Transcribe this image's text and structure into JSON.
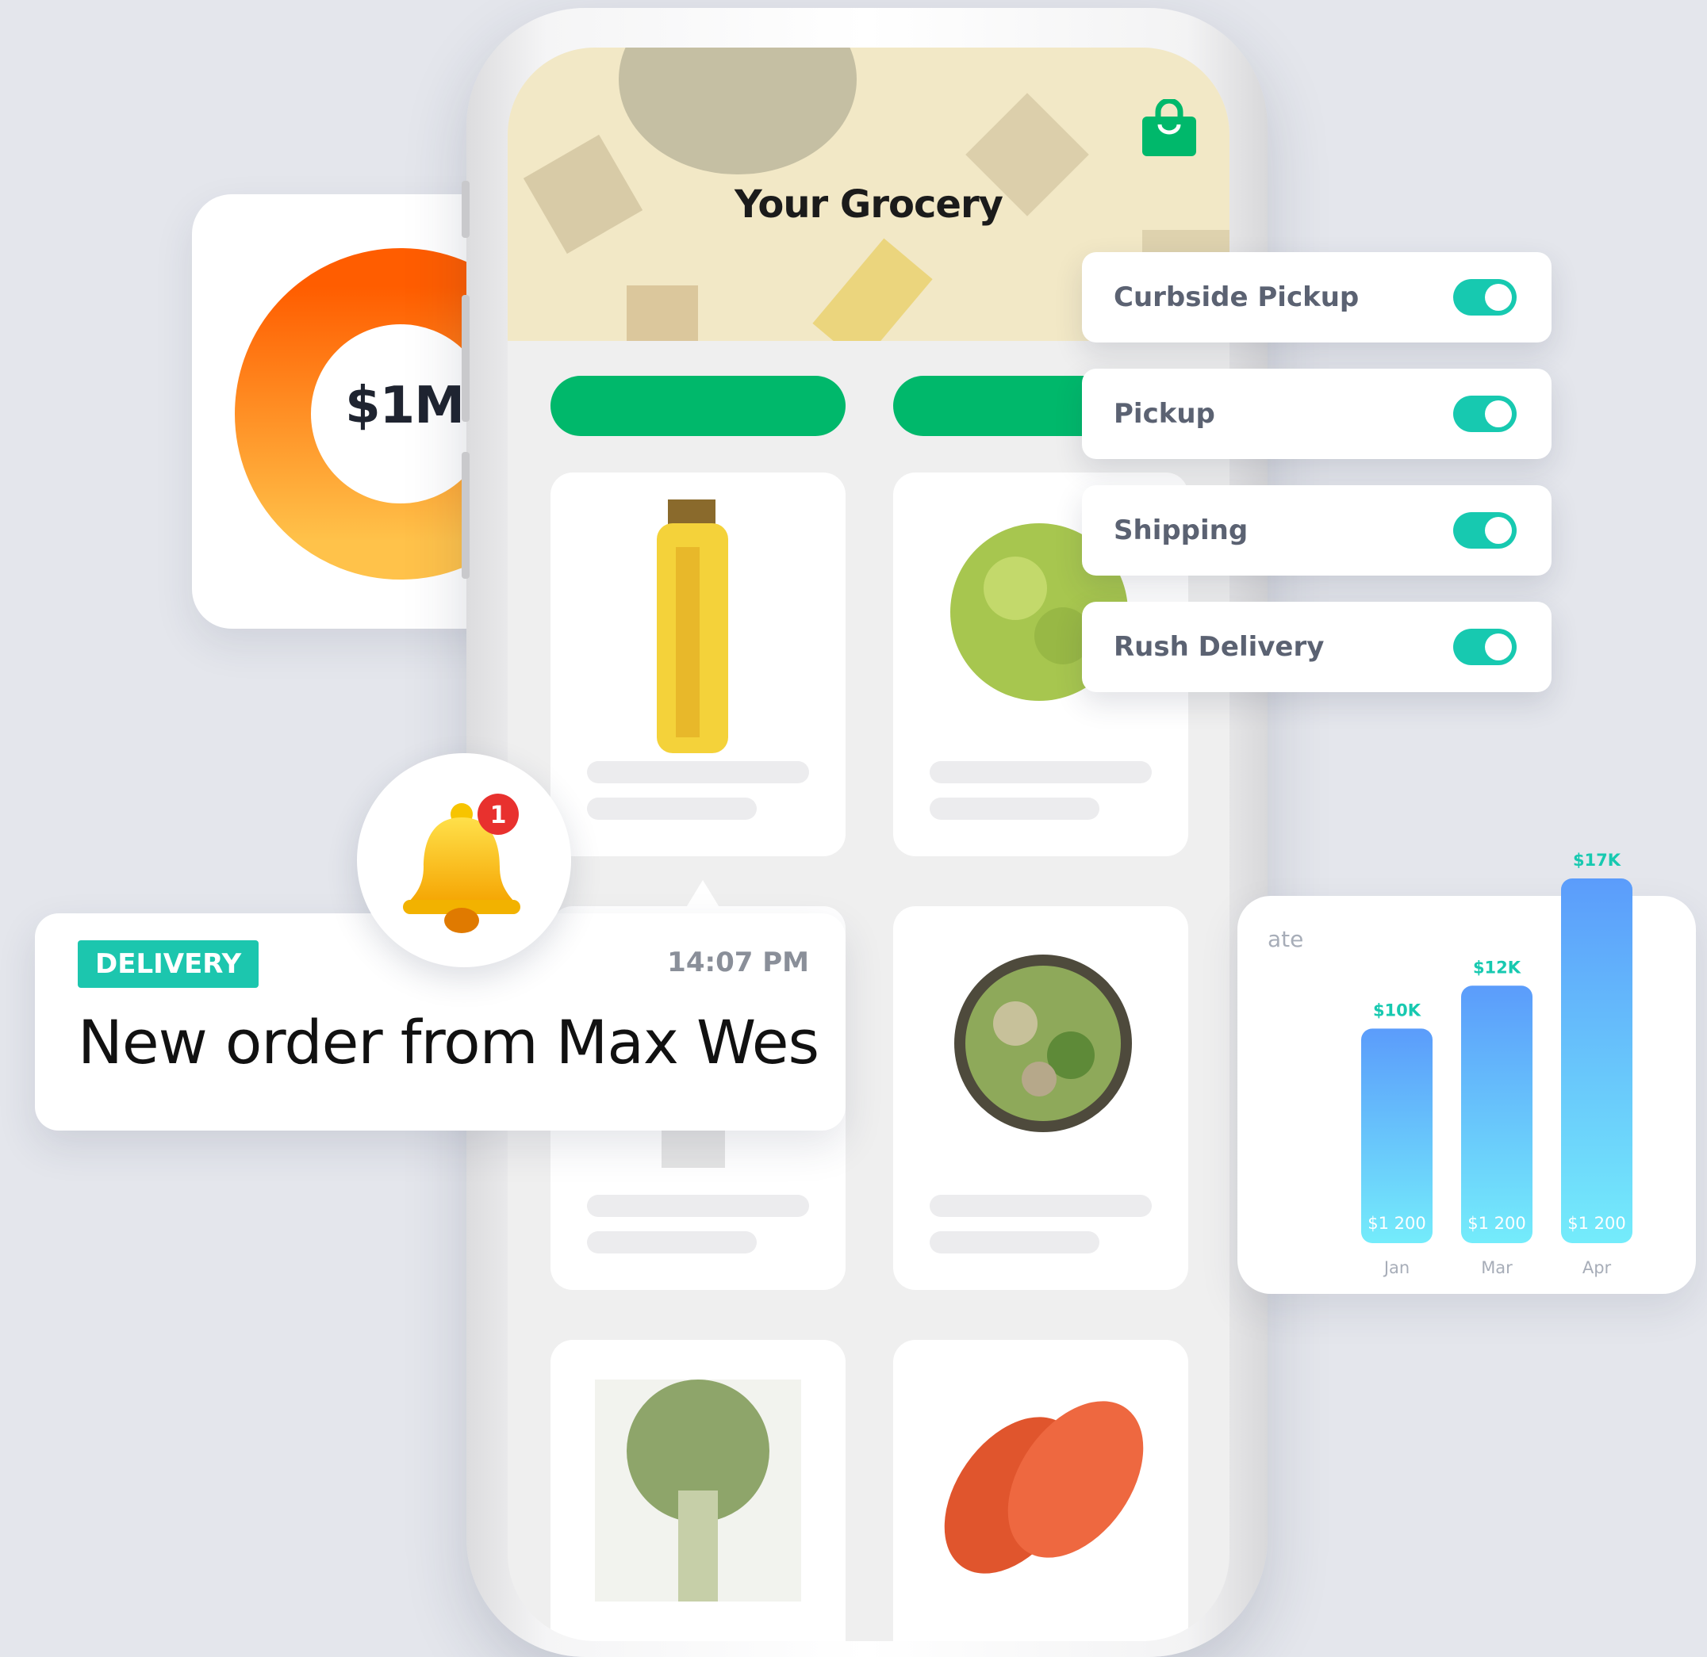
{
  "donut_card": {
    "value_label": "$1M"
  },
  "app": {
    "title": "Your Grocery"
  },
  "delivery_options": [
    {
      "label": "Curbside Pickup",
      "enabled": true
    },
    {
      "label": "Pickup",
      "enabled": true
    },
    {
      "label": "Shipping",
      "enabled": true
    },
    {
      "label": "Rush Delivery",
      "enabled": true
    }
  ],
  "notification": {
    "badge": "DELIVERY",
    "time": "14:07 PM",
    "message": "New order from Max Wes",
    "count": "1"
  },
  "chart_fragment_label": "ate",
  "chart_data": {
    "type": "bar",
    "categories": [
      "Jan",
      "Mar",
      "Apr"
    ],
    "values": [
      10,
      12,
      17
    ],
    "value_labels": [
      "$10K",
      "$12K",
      "$17K"
    ],
    "inner_labels": [
      "$1 200",
      "$1 200",
      "$1 200"
    ],
    "ylim": [
      0,
      17
    ]
  },
  "colors": {
    "brand_green": "#00b86b",
    "toggle_teal": "#17c9b0",
    "badge_teal": "#1cc6ae",
    "bar_top": "#5b9cfb",
    "bar_bottom": "#74ecfb",
    "donut_top": "#ff6000",
    "donut_bottom": "#ffc348"
  }
}
